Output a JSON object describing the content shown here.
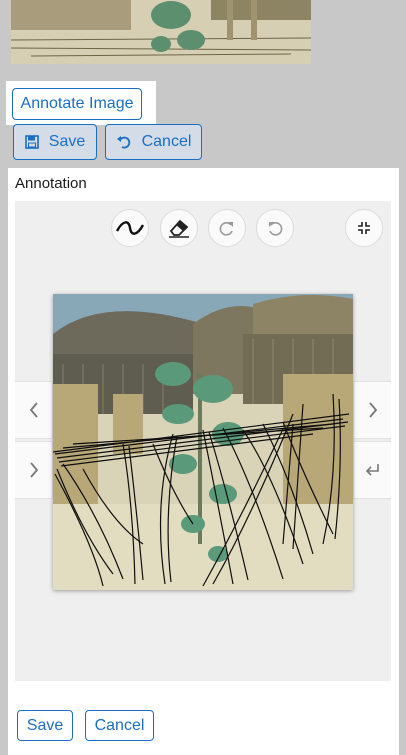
{
  "toolbar": {
    "annotate_label": "Annotate Image",
    "save_label": "Save",
    "cancel_label": "Cancel"
  },
  "panel": {
    "title": "Annotation"
  },
  "tools": {
    "draw": "draw-curve-icon",
    "erase": "eraser-icon",
    "redo": "redo-icon",
    "undo": "undo-icon",
    "collapse": "collapse-icon"
  },
  "footer": {
    "save_label": "Save",
    "cancel_label": "Cancel"
  },
  "colors": {
    "accent": "#1a6fc4"
  }
}
